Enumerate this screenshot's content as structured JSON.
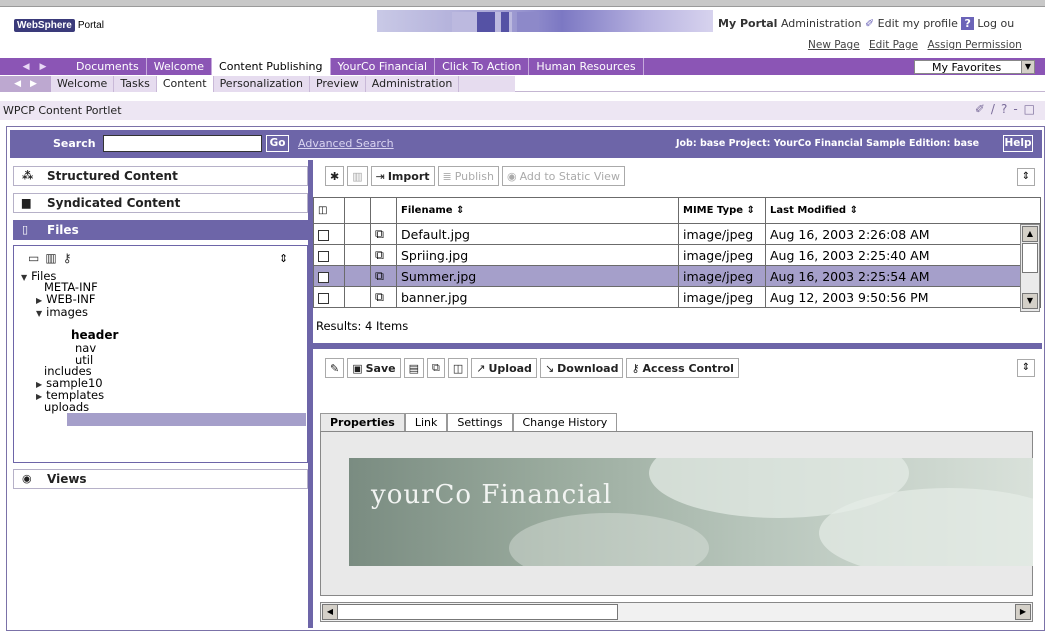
{
  "header": {
    "logo_brand": "WebSphere",
    "logo_product": "Portal",
    "links": [
      "My Portal",
      "Administration",
      "Edit my profile",
      "?",
      "Log ou"
    ],
    "sublinks": [
      "New Page",
      "Edit Page",
      "Assign Permission"
    ]
  },
  "nav1": {
    "tabs": [
      "Documents",
      "Welcome",
      "Content Publishing",
      "YourCo Financial",
      "Click To Action",
      "Human Resources"
    ],
    "active": "Content Publishing",
    "favorites": "My Favorites"
  },
  "nav2": {
    "tabs": [
      "Welcome",
      "Tasks",
      "Content",
      "Personalization",
      "Preview",
      "Administration"
    ],
    "active": "Content"
  },
  "portlet": {
    "title": "WPCP Content Portlet"
  },
  "search": {
    "label": "Search",
    "go": "Go",
    "advanced": "Advanced Search",
    "job_info": "Job: base   Project: YourCo Financial Sample   Edition: base",
    "help": "Help"
  },
  "left": {
    "sections": [
      "Structured Content",
      "Syndicated Content",
      "Files",
      "Views"
    ],
    "tree": [
      {
        "label": "Files",
        "arrow": "down"
      },
      {
        "label": "META-INF",
        "arrow": ""
      },
      {
        "label": "WEB-INF",
        "arrow": "right"
      },
      {
        "label": "images",
        "arrow": "down"
      },
      {
        "label": "header",
        "arrow": ""
      },
      {
        "label": "nav",
        "arrow": ""
      },
      {
        "label": "util",
        "arrow": ""
      },
      {
        "label": "includes",
        "arrow": ""
      },
      {
        "label": "sample10",
        "arrow": "right"
      },
      {
        "label": "templates",
        "arrow": "right"
      },
      {
        "label": "uploads",
        "arrow": ""
      }
    ]
  },
  "files_toolbar": {
    "import": "Import",
    "publish": "Publish",
    "add_static": "Add to Static View"
  },
  "table": {
    "columns": [
      "Filename ⇕",
      "MIME Type ⇕",
      "Last Modified ⇕"
    ],
    "rows": [
      {
        "name": "Default.jpg",
        "mime": "image/jpeg",
        "modified": "Aug 16, 2003 2:26:08 AM"
      },
      {
        "name": "Spriing.jpg",
        "mime": "image/jpeg",
        "modified": "Aug 16, 2003 2:25:40 AM"
      },
      {
        "name": "Summer.jpg",
        "mime": "image/jpeg",
        "modified": "Aug 16, 2003 2:25:54 AM"
      },
      {
        "name": "banner.jpg",
        "mime": "image/jpeg",
        "modified": "Aug 12, 2003 9:50:56 PM"
      }
    ],
    "results": "Results: 4 Items"
  },
  "detail_toolbar": {
    "save": "Save",
    "upload": "Upload",
    "download": "Download",
    "access": "Access Control"
  },
  "detail_tabs": [
    "Properties",
    "Link",
    "Settings",
    "Change History"
  ],
  "preview": {
    "image_text": "yourCo Financial"
  }
}
